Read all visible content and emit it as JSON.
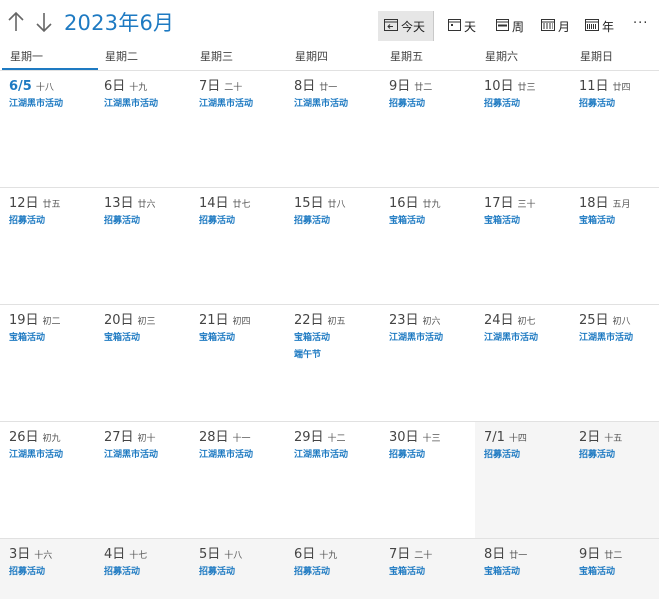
{
  "toolbar": {
    "title": "2023年6月",
    "today_label": "今天",
    "day_label": "天",
    "week_label": "周",
    "month_label": "月",
    "year_label": "年",
    "more_label": "···"
  },
  "weekdays": [
    "星期一",
    "星期二",
    "星期三",
    "星期四",
    "星期五",
    "星期六",
    "星期日"
  ],
  "weeks": [
    [
      {
        "label": "6/5",
        "lunar": "十八",
        "today": true,
        "events": [
          "江湖黑市活动"
        ]
      },
      {
        "label": "6日",
        "lunar": "十九",
        "events": [
          "江湖黑市活动"
        ]
      },
      {
        "label": "7日",
        "lunar": "二十",
        "events": [
          "江湖黑市活动"
        ]
      },
      {
        "label": "8日",
        "lunar": "廿一",
        "events": [
          "江湖黑市活动"
        ]
      },
      {
        "label": "9日",
        "lunar": "廿二",
        "events": [
          "招募活动"
        ]
      },
      {
        "label": "10日",
        "lunar": "廿三",
        "events": [
          "招募活动"
        ]
      },
      {
        "label": "11日",
        "lunar": "廿四",
        "events": [
          "招募活动"
        ]
      }
    ],
    [
      {
        "label": "12日",
        "lunar": "廿五",
        "events": [
          "招募活动"
        ]
      },
      {
        "label": "13日",
        "lunar": "廿六",
        "events": [
          "招募活动"
        ]
      },
      {
        "label": "14日",
        "lunar": "廿七",
        "events": [
          "招募活动"
        ]
      },
      {
        "label": "15日",
        "lunar": "廿八",
        "events": [
          "招募活动"
        ]
      },
      {
        "label": "16日",
        "lunar": "廿九",
        "events": [
          "宝箱活动"
        ]
      },
      {
        "label": "17日",
        "lunar": "三十",
        "events": [
          "宝箱活动"
        ]
      },
      {
        "label": "18日",
        "lunar": "五月",
        "events": [
          "宝箱活动"
        ]
      }
    ],
    [
      {
        "label": "19日",
        "lunar": "初二",
        "events": [
          "宝箱活动"
        ]
      },
      {
        "label": "20日",
        "lunar": "初三",
        "events": [
          "宝箱活动"
        ]
      },
      {
        "label": "21日",
        "lunar": "初四",
        "events": [
          "宝箱活动"
        ]
      },
      {
        "label": "22日",
        "lunar": "初五",
        "events": [
          "宝箱活动",
          "端午节"
        ]
      },
      {
        "label": "23日",
        "lunar": "初六",
        "events": [
          "江湖黑市活动"
        ]
      },
      {
        "label": "24日",
        "lunar": "初七",
        "events": [
          "江湖黑市活动"
        ]
      },
      {
        "label": "25日",
        "lunar": "初八",
        "events": [
          "江湖黑市活动"
        ]
      }
    ],
    [
      {
        "label": "26日",
        "lunar": "初九",
        "events": [
          "江湖黑市活动"
        ]
      },
      {
        "label": "27日",
        "lunar": "初十",
        "events": [
          "江湖黑市活动"
        ]
      },
      {
        "label": "28日",
        "lunar": "十一",
        "events": [
          "江湖黑市活动"
        ]
      },
      {
        "label": "29日",
        "lunar": "十二",
        "events": [
          "江湖黑市活动"
        ]
      },
      {
        "label": "30日",
        "lunar": "十三",
        "events": [
          "招募活动"
        ]
      },
      {
        "label": "7/1",
        "lunar": "十四",
        "other": true,
        "events": [
          "招募活动"
        ]
      },
      {
        "label": "2日",
        "lunar": "十五",
        "other": true,
        "events": [
          "招募活动"
        ]
      }
    ],
    [
      {
        "label": "3日",
        "lunar": "十六",
        "other": true,
        "events": [
          "招募活动"
        ]
      },
      {
        "label": "4日",
        "lunar": "十七",
        "other": true,
        "events": [
          "招募活动"
        ]
      },
      {
        "label": "5日",
        "lunar": "十八",
        "other": true,
        "events": [
          "招募活动"
        ]
      },
      {
        "label": "6日",
        "lunar": "十九",
        "other": true,
        "events": [
          "招募活动"
        ]
      },
      {
        "label": "7日",
        "lunar": "二十",
        "other": true,
        "events": [
          "宝箱活动"
        ]
      },
      {
        "label": "8日",
        "lunar": "廿一",
        "other": true,
        "events": [
          "宝箱活动"
        ]
      },
      {
        "label": "9日",
        "lunar": "廿二",
        "other": true,
        "events": [
          "宝箱活动"
        ]
      }
    ]
  ],
  "colors": {
    "accent": "#1e7ac2",
    "other_month_bg": "#f5f5f5",
    "grid_line": "#e1e1e1"
  }
}
